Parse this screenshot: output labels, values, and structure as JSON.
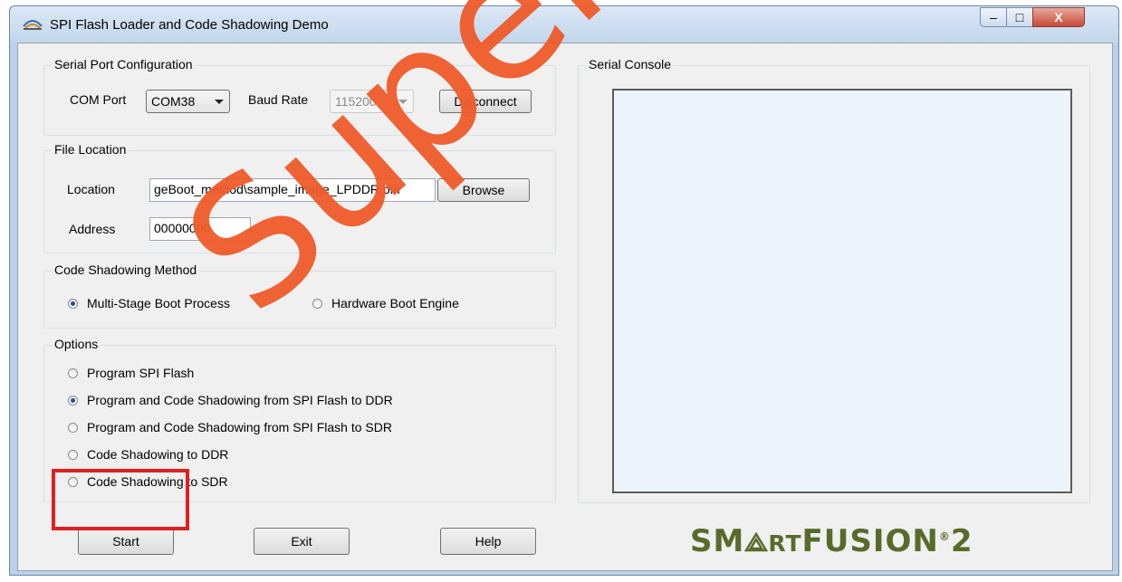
{
  "window": {
    "title": "SPI Flash Loader and Code Shadowing Demo",
    "controls": {
      "minimize": "–",
      "maximize": "□",
      "close": "X"
    }
  },
  "serial_port": {
    "group_label": "Serial Port Configuration",
    "com_port_label": "COM Port",
    "com_port_value": "COM38",
    "baud_rate_label": "Baud Rate",
    "baud_rate_value": "115200",
    "disconnect_label": "Disconnect"
  },
  "file_location": {
    "group_label": "File Location",
    "location_label": "Location",
    "location_value": "geBoot_method\\sample_image_LPDDR.bin",
    "browse_label": "Browse",
    "address_label": "Address",
    "address_value": "00000000"
  },
  "shadowing_method": {
    "group_label": "Code Shadowing Method",
    "options": [
      {
        "label": "Multi-Stage Boot Process",
        "selected": true
      },
      {
        "label": "Hardware Boot Engine",
        "selected": false
      }
    ]
  },
  "options": {
    "group_label": "Options",
    "items": [
      {
        "label": "Program SPI Flash",
        "selected": false
      },
      {
        "label": "Program and Code Shadowing from SPI Flash to DDR",
        "selected": true
      },
      {
        "label": "Program and Code Shadowing from SPI Flash to SDR",
        "selected": false
      },
      {
        "label": "Code Shadowing to DDR",
        "selected": false
      },
      {
        "label": "Code Shadowing to SDR",
        "selected": false
      }
    ]
  },
  "console": {
    "group_label": "Serial Console"
  },
  "buttons": {
    "start": "Start",
    "exit": "Exit",
    "help": "Help"
  },
  "logo": {
    "part1": "SM",
    "part2": "RT",
    "part3": "FUSION",
    "part4": "2"
  },
  "watermark": {
    "text": "Superseded"
  },
  "colors": {
    "watermark": "#ef5b2a",
    "highlight": "#e02020",
    "logo": "#586b2a"
  }
}
